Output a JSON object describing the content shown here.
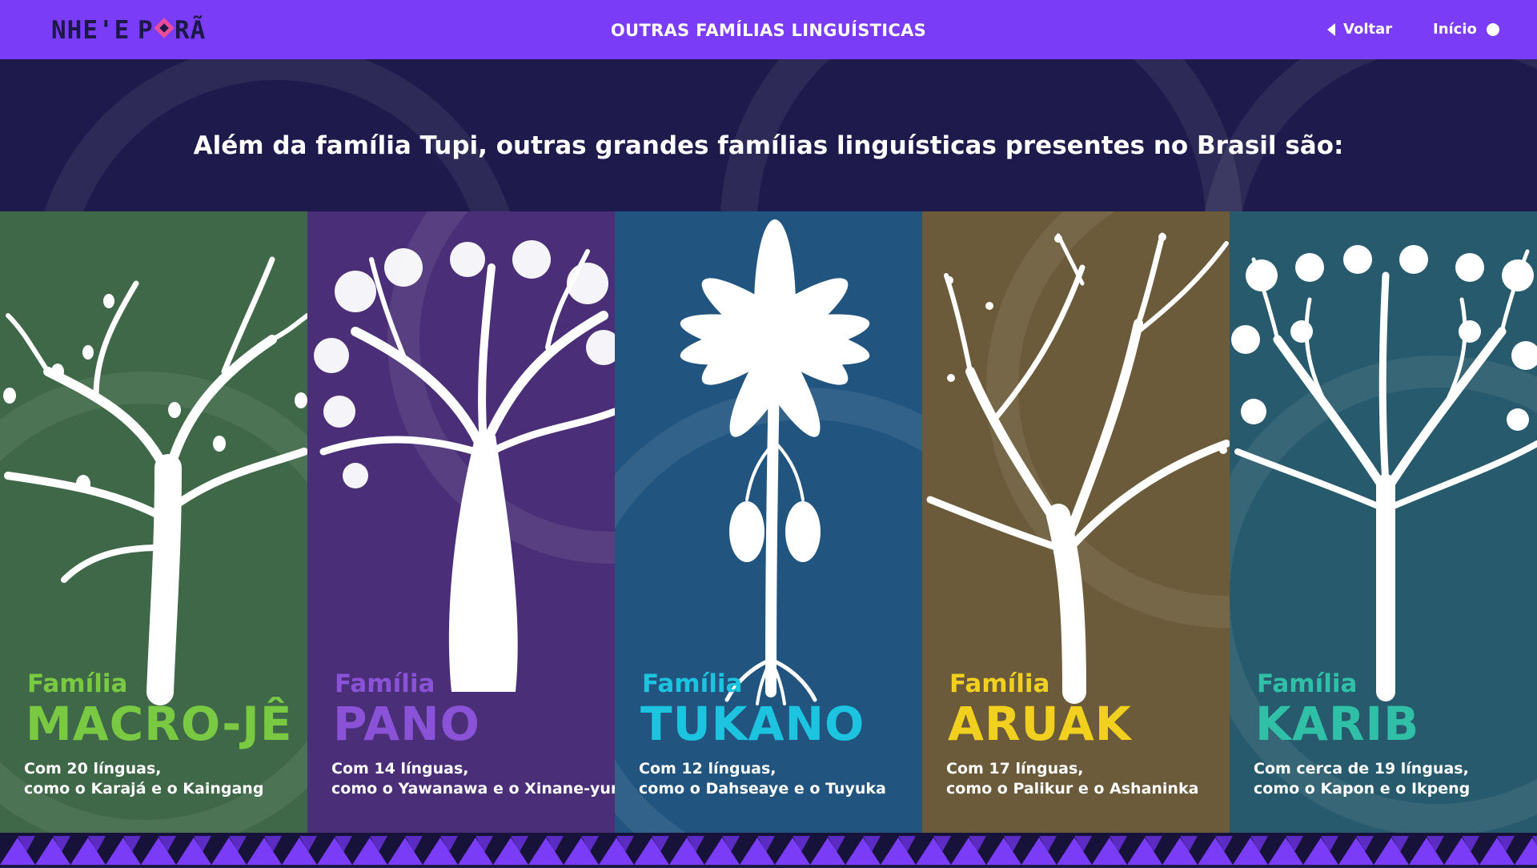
{
  "header": {
    "logo_text": "NHE'E PORÃ",
    "title": "OUTRAS FAMÍLIAS LINGUÍSTICAS",
    "back_label": "Voltar",
    "home_label": "Início"
  },
  "intro": {
    "text": "Além da família Tupi, outras grandes famílias linguísticas presentes no Brasil são:"
  },
  "families": [
    {
      "label": "Família",
      "name": "MACRO-JÊ",
      "line1": "Com 20 línguas,",
      "line2": "como o Karajá e o Kaingang",
      "bg": "#3e6847",
      "accent": "#7ac943"
    },
    {
      "label": "Família",
      "name": "PANO",
      "line1": "Com 14 línguas,",
      "line2": "como o Yawanawa e o Xinane-yura",
      "bg": "#4a2f78",
      "accent": "#8a52d6"
    },
    {
      "label": "Família",
      "name": "TUKANO",
      "line1": "Com 12 línguas,",
      "line2": "como o Dahseaye e o Tuyuka",
      "bg": "#21557f",
      "accent": "#1cc4e0"
    },
    {
      "label": "Família",
      "name": "ARUAK",
      "line1": "Com 17 línguas,",
      "line2": "como o Palikur e o Ashaninka",
      "bg": "#6b5b3a",
      "accent": "#f2d01f"
    },
    {
      "label": "Família",
      "name": "KARIB",
      "line1": "Com cerca de 19 línguas,",
      "line2": "como o Kapon e o Ikpeng",
      "bg": "#265a6c",
      "accent": "#2fc0a7"
    }
  ],
  "colors": {
    "topbar": "#7a3cf6",
    "background": "#1c1848"
  }
}
